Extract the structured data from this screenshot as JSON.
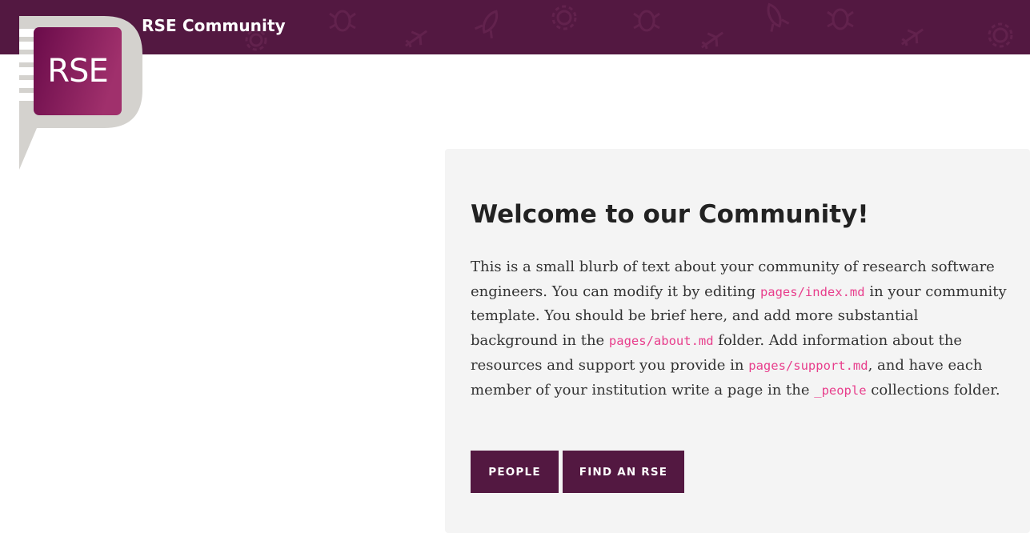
{
  "header": {
    "site_title": "RSE Community",
    "background_color": "#531841",
    "pattern_icons": [
      "rocket-icon",
      "bug-icon",
      "airplane-icon",
      "gear-icon"
    ]
  },
  "logo": {
    "text": "RSE",
    "gradient_colors": [
      "#6a0b4a",
      "#a0306c"
    ],
    "bubble_color": "#d4d2ce"
  },
  "hero": {
    "title": "Welcome to our Community!",
    "blurb": {
      "t1": "This is a small blurb of text about your community of research software engineers. You can modify it by editing ",
      "code1": "pages/index.md",
      "t2": " in your community template. You should be brief here, and add more substantial background in the ",
      "code2": "pages/about.md",
      "t3": " folder. Add information about the resources and support you provide in ",
      "code3": "pages/support.md",
      "t4": ", and have each member of your institution write a page in the ",
      "code4": "_people",
      "t5": " collections folder."
    },
    "buttons": {
      "people": "PEOPLE",
      "find_rse": "FIND AN RSE"
    }
  }
}
